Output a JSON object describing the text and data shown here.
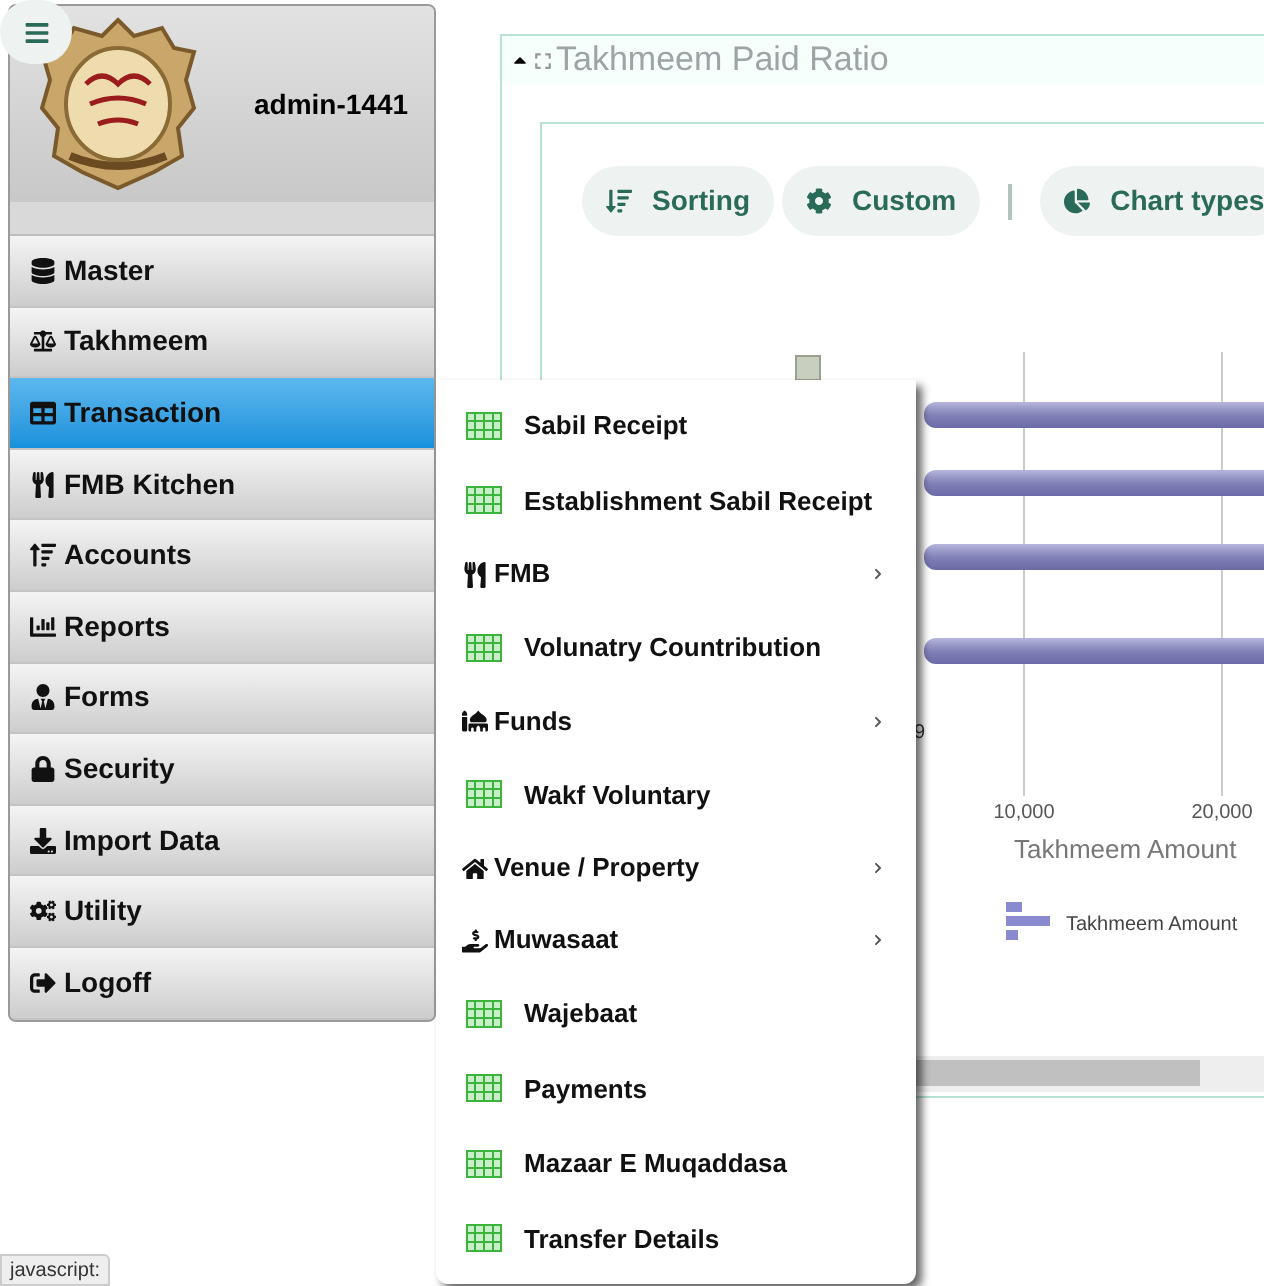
{
  "sidebar": {
    "user": "admin-1441",
    "items": [
      {
        "label": "Master",
        "selected": false
      },
      {
        "label": "Takhmeem",
        "selected": false
      },
      {
        "label": "Transaction",
        "selected": true
      },
      {
        "label": "FMB Kitchen",
        "selected": false
      },
      {
        "label": "Accounts",
        "selected": false
      },
      {
        "label": "Reports",
        "selected": false
      },
      {
        "label": "Forms",
        "selected": false
      },
      {
        "label": "Security",
        "selected": false
      },
      {
        "label": "Import Data",
        "selected": false
      },
      {
        "label": "Utility",
        "selected": false
      },
      {
        "label": "Logoff",
        "selected": false
      }
    ]
  },
  "submenu": {
    "items": [
      {
        "label": "Sabil Receipt",
        "kind": "link"
      },
      {
        "label": "Establishment Sabil Receipt",
        "kind": "link"
      },
      {
        "label": "FMB",
        "kind": "submenu"
      },
      {
        "label": "Volunatry Countribution",
        "kind": "link"
      },
      {
        "label": "Funds",
        "kind": "submenu"
      },
      {
        "label": "Wakf Voluntary",
        "kind": "link"
      },
      {
        "label": "Venue / Property",
        "kind": "submenu"
      },
      {
        "label": "Muwasaat",
        "kind": "submenu"
      },
      {
        "label": "Wajebaat",
        "kind": "link"
      },
      {
        "label": "Payments",
        "kind": "link"
      },
      {
        "label": "Mazaar E Muqaddasa",
        "kind": "link"
      },
      {
        "label": "Transfer Details",
        "kind": "link"
      }
    ]
  },
  "panel": {
    "title": "Takhmeem Paid Ratio",
    "toolbar": [
      "Sorting",
      "Custom",
      "Chart types"
    ],
    "chart": {
      "bar_label_fragment": "9",
      "x_ticks": [
        "10,000",
        "20,000"
      ],
      "x_title": "Takhmeem Amount",
      "legend": "Takhmeem Amount"
    }
  },
  "status_bar": "javascript:"
}
